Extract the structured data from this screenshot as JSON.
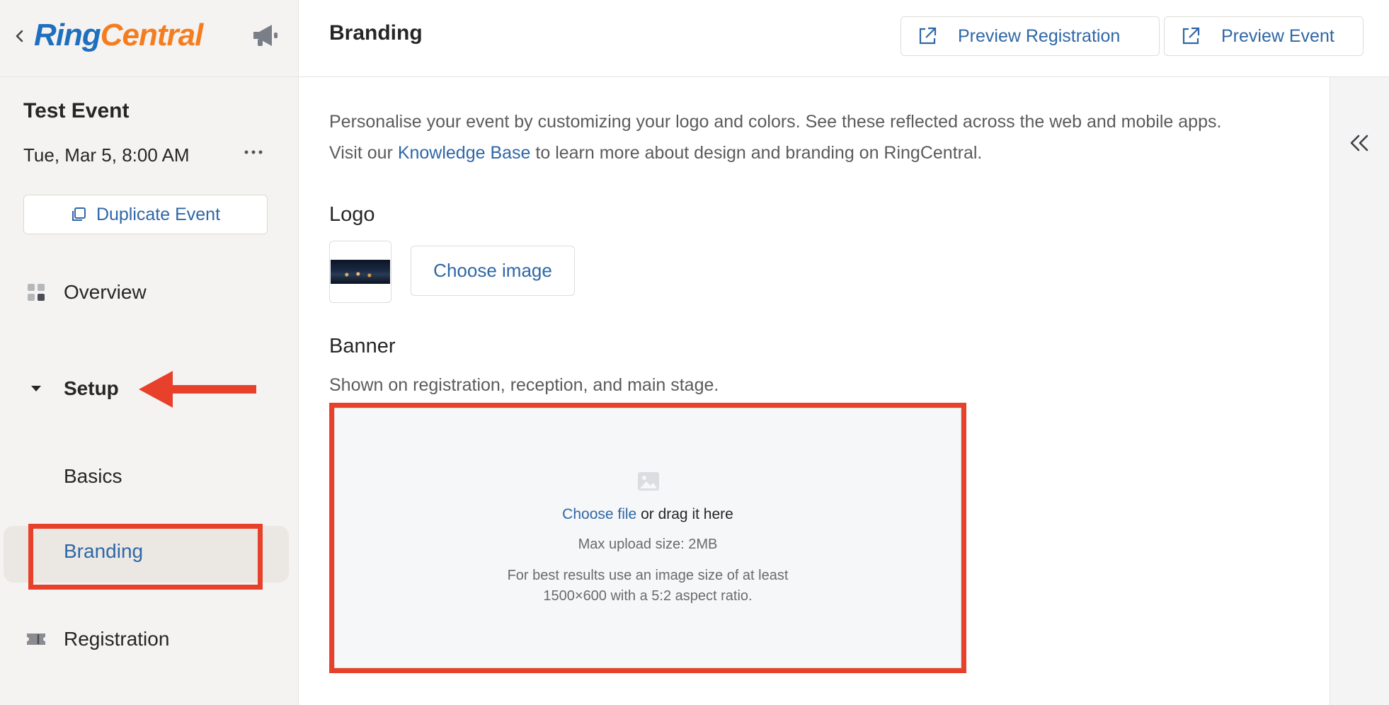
{
  "brand": {
    "logo_part1": "Ring",
    "logo_part2": "Central"
  },
  "event": {
    "name": "Test Event",
    "date": "Tue, Mar 5, 8:00 AM",
    "duplicate_label": "Duplicate Event"
  },
  "nav": {
    "overview": "Overview",
    "setup": "Setup",
    "basics": "Basics",
    "branding": "Branding",
    "registration": "Registration"
  },
  "header": {
    "title": "Branding",
    "preview_registration": "Preview Registration",
    "preview_event": "Preview Event"
  },
  "intro": {
    "line1": "Personalise your event by customizing your logo and colors. See these reflected across the web and mobile apps.",
    "line2_pre": "Visit our ",
    "link": "Knowledge Base",
    "line2_post": " to learn more about design and branding on RingCentral."
  },
  "logo_section": {
    "title": "Logo",
    "choose_image": "Choose image"
  },
  "banner_section": {
    "title": "Banner",
    "subtitle": "Shown on registration, reception, and main stage.",
    "choose_file": "Choose file",
    "drag_text": " or drag it here",
    "max_size": "Max upload size: 2MB",
    "hint_line1": "For best results use an image size of at least",
    "hint_line2": "1500×600 with a 5:2 aspect ratio."
  },
  "colors": {
    "accent": "#2f67a6",
    "highlight": "#e8412b",
    "logo_blue": "#1f6fbf",
    "logo_orange": "#f57d20"
  },
  "icons": {
    "back": "chevron-left-icon",
    "megaphone": "megaphone-icon",
    "more": "more-dots-icon",
    "duplicate": "copy-icon",
    "overview": "grid-icon",
    "setup": "caret-down-icon",
    "registration": "ticket-icon",
    "external": "external-link-icon",
    "collapse": "double-chevron-left-icon",
    "image": "image-icon"
  }
}
